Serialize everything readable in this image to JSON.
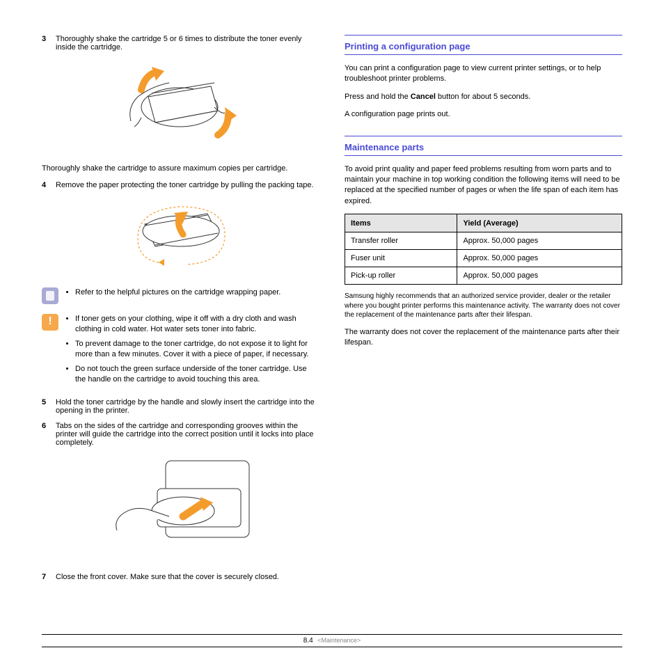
{
  "left": {
    "step3": {
      "num": "3",
      "text": "Thoroughly shake the cartridge 5 or 6 times to distribute the toner evenly inside the cartridge."
    },
    "shake_caption": "Thoroughly shake the cartridge to assure maximum copies per cartridge.",
    "step4": {
      "num": "4",
      "text": "Remove the paper protecting the toner cartridge by pulling the packing tape."
    },
    "info_note": "Refer to the helpful pictures on the cartridge wrapping paper.",
    "warnings": [
      "If toner gets on your clothing, wipe it off with a dry cloth and wash clothing in cold water. Hot water sets toner into fabric.",
      "To prevent damage to the toner cartridge, do not expose it to light for more than a few minutes. Cover it with a piece of paper, if necessary.",
      "Do not touch the green surface underside of the toner cartridge. Use the handle on the cartridge to avoid touching this area."
    ],
    "step5": {
      "num": "5",
      "text": "Hold the toner cartridge by the handle and slowly insert the cartridge into the opening in the printer."
    },
    "step6": {
      "num": "6",
      "text": "Tabs on the sides of the cartridge and corresponding grooves within the printer will guide the cartridge into the correct position until it locks into place completely."
    },
    "step7": {
      "num": "7",
      "text": "Close the front cover. Make sure that the cover is securely closed."
    }
  },
  "right": {
    "heading1": "Printing a configuration page",
    "config_intro": "You can print a configuration page to view current printer settings, or to help troubleshoot printer problems.",
    "config_press_pre": "Press and hold the ",
    "config_button": "Cancel",
    "config_press_post": " button for about 5 seconds.",
    "config_result": "A configuration page prints out.",
    "heading2": "Maintenance parts",
    "maint_intro": "To avoid print quality and paper feed problems resulting from worn parts and to maintain your machine in top working condition the following items will need to be replaced at the specified number of pages or when the life span of each item has expired.",
    "table": {
      "headers": [
        "Items",
        "Yield (Average)"
      ],
      "rows": [
        [
          "Transfer roller",
          "Approx. 50,000 pages"
        ],
        [
          "Fuser unit",
          "Approx. 50,000 pages"
        ],
        [
          "Pick-up roller",
          "Approx. 50,000 pages"
        ]
      ]
    },
    "maint_note1": "Samsung highly recommends that an authorized service provider, dealer or the retailer where you bought printer performs this maintenance activity. The warranty does not cover the replacement of the maintenance parts after their lifespan.",
    "maint_note2": "The warranty does not cover the replacement of the maintenance parts after their lifespan."
  },
  "footer": {
    "page": "8.4",
    "section": "<Maintenance>"
  }
}
